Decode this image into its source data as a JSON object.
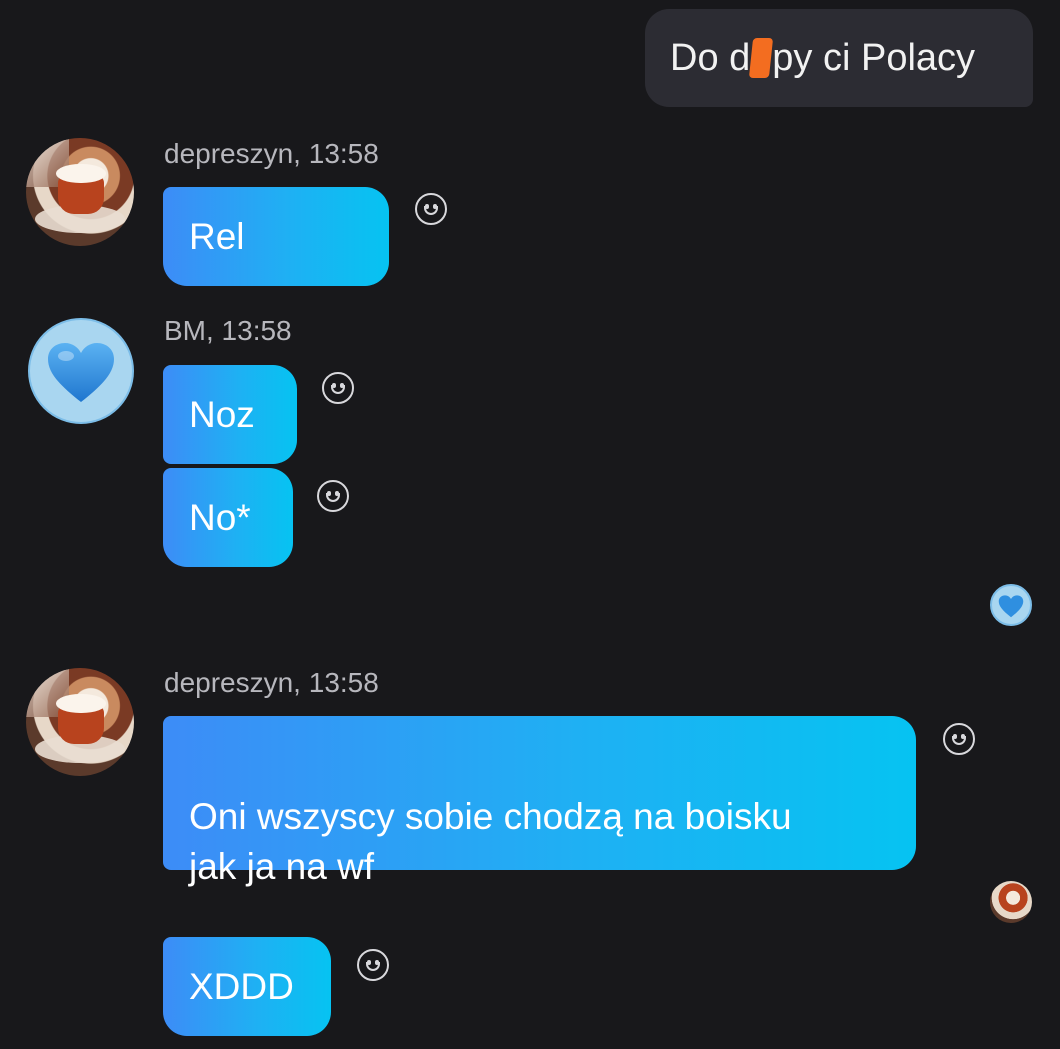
{
  "outgoing": {
    "text_before": "Do d",
    "text_after": "py ci Polacy"
  },
  "groups": [
    {
      "sender": "depreszyn",
      "time": "13:58",
      "header": "depreszyn, 13:58",
      "messages": [
        "Rel"
      ]
    },
    {
      "sender": "BM",
      "time": "13:58",
      "header": "BM, 13:58",
      "messages": [
        "Noz",
        "No*"
      ]
    },
    {
      "sender": "depreszyn",
      "time": "13:58",
      "header": "depreszyn, 13:58",
      "messages": [
        "Oni wszyscy sobie chodzą na boisku\njak ja na wf",
        "XDDD"
      ]
    }
  ],
  "icons": {
    "reaction": "smiley-reaction-icon",
    "avatar_bm": "blue-heart-icon",
    "avatar_depreszyn": "hot-chocolate-photo"
  },
  "colors": {
    "background": "#18181b",
    "outgoing_bubble": "#2c2c33",
    "incoming_gradient_start": "#3d8cf7",
    "incoming_gradient_end": "#06c3f2",
    "censor_mark": "#f36d20",
    "heart": "#2f8fe0"
  }
}
